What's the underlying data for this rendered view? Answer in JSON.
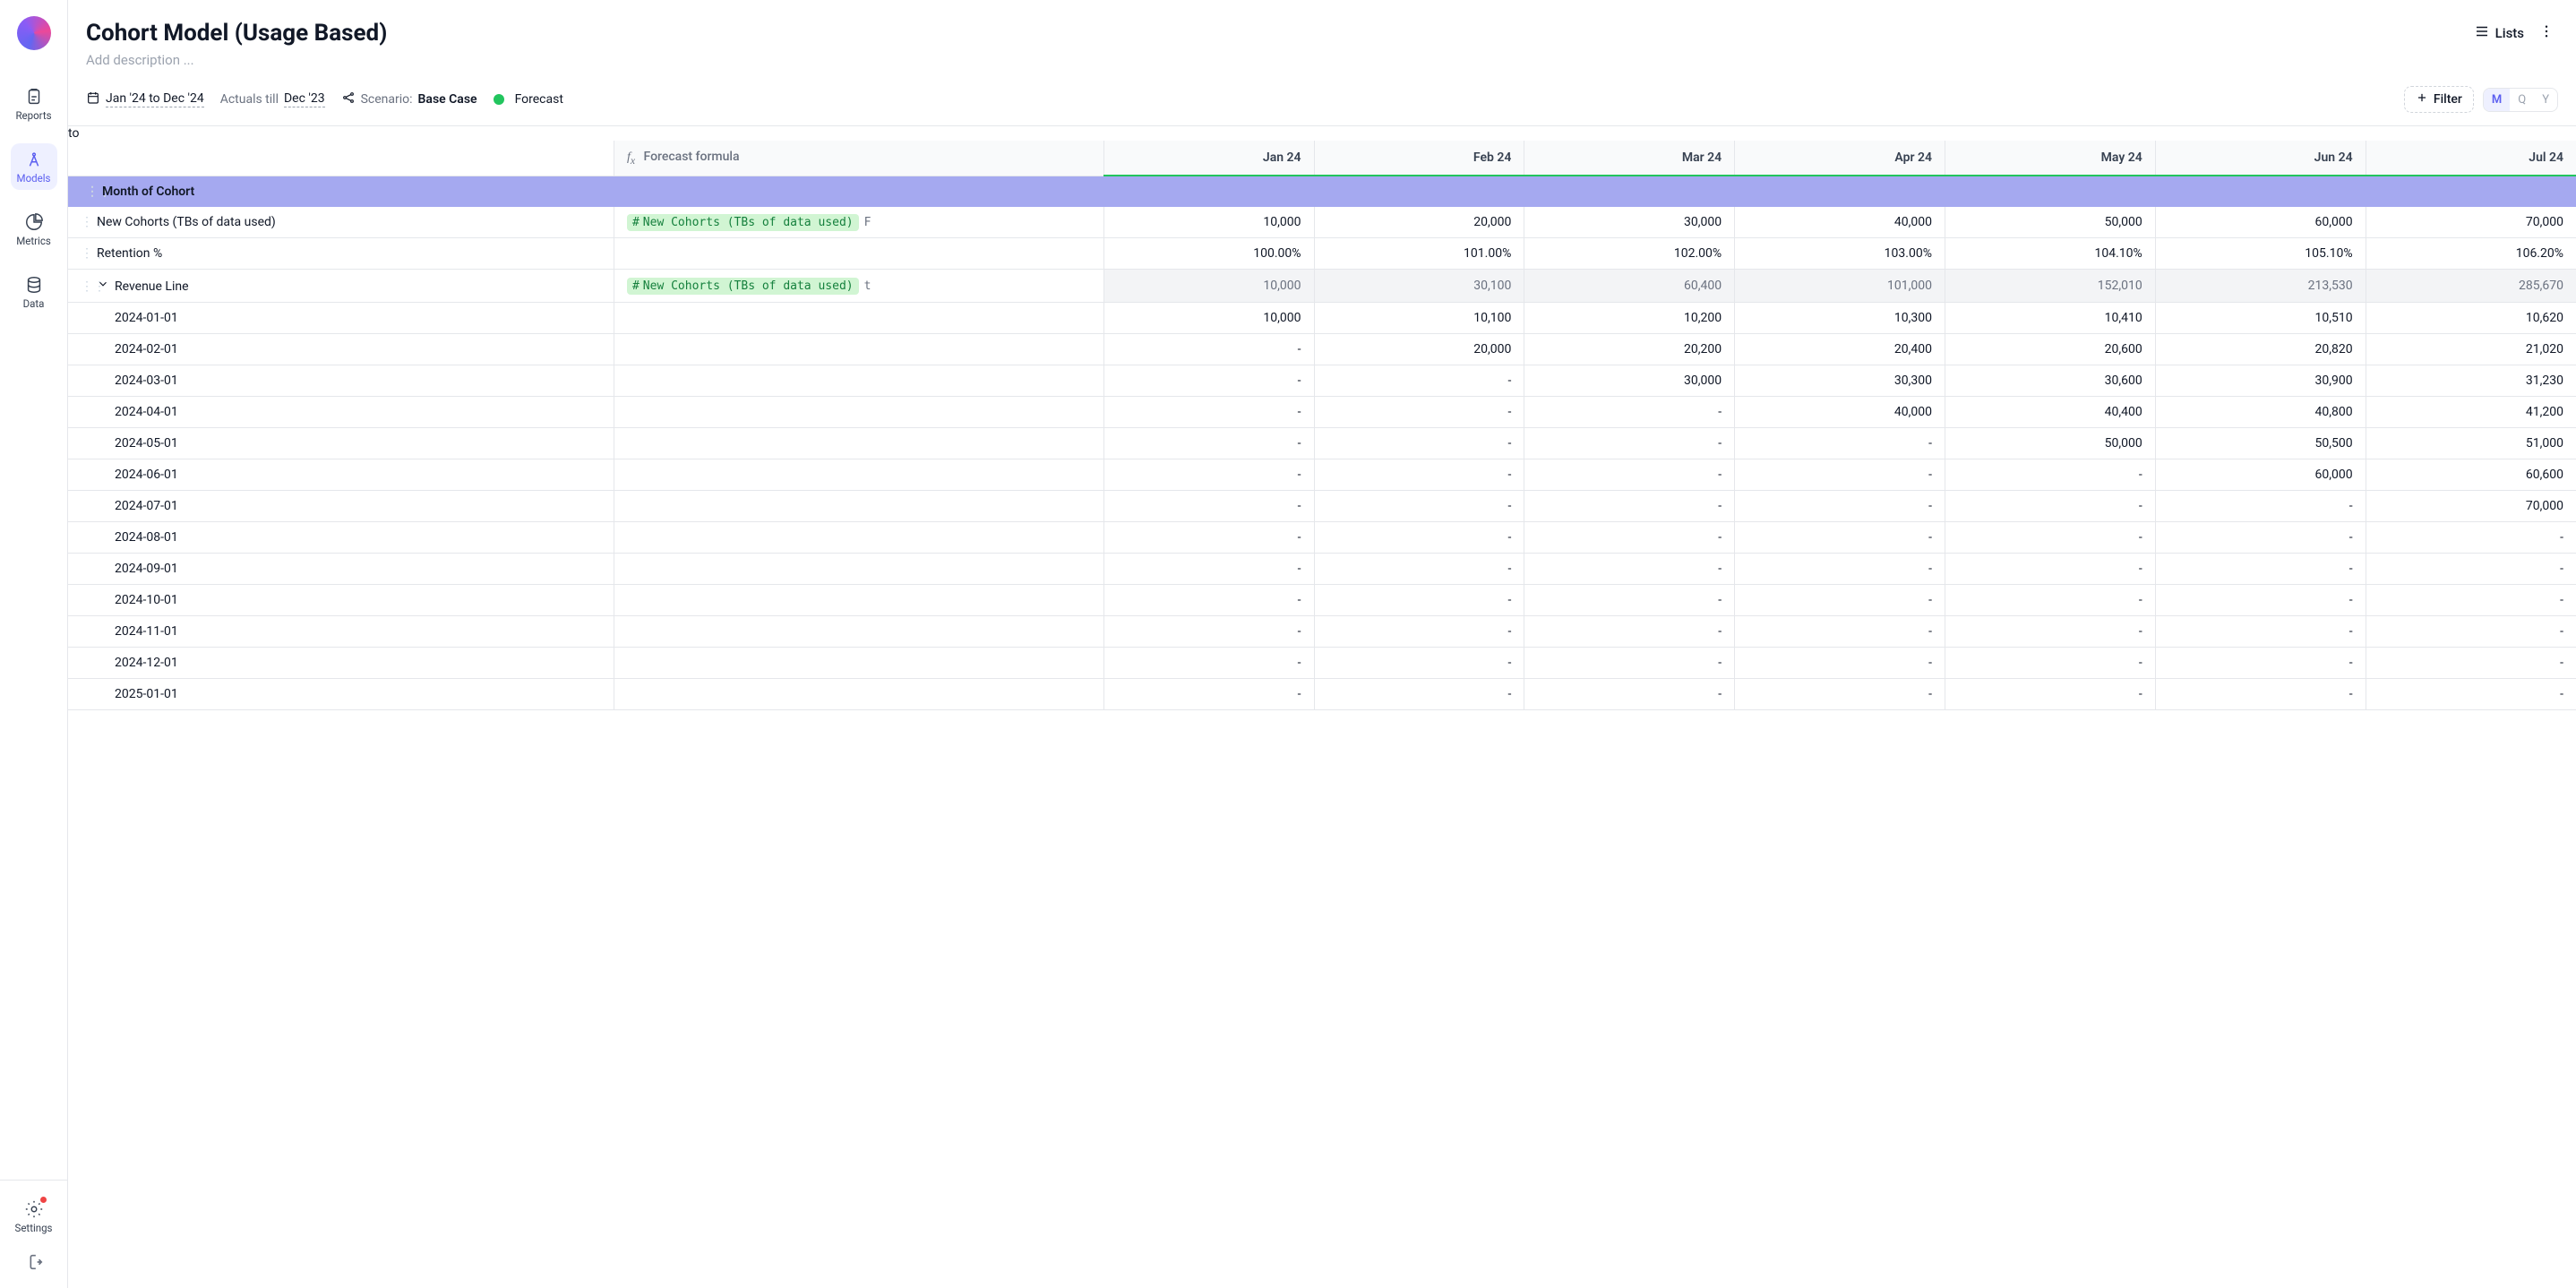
{
  "sidebar": {
    "items": [
      {
        "key": "reports",
        "label": "Reports"
      },
      {
        "key": "models",
        "label": "Models"
      },
      {
        "key": "metrics",
        "label": "Metrics"
      },
      {
        "key": "data",
        "label": "Data"
      }
    ],
    "settings_label": "Settings"
  },
  "header": {
    "title": "Cohort Model (Usage Based)",
    "description_placeholder": "Add description ...",
    "lists_label": "Lists"
  },
  "toolbar": {
    "date_range": "Jan '24 to Dec '24",
    "actuals_label": "Actuals till",
    "actuals_till": "Dec '23",
    "scenario_label": "Scenario:",
    "scenario_value": "Base Case",
    "forecast_label": "Forecast",
    "filter_label": "Filter",
    "granularity": {
      "m": "M",
      "q": "Q",
      "y": "Y"
    }
  },
  "grid": {
    "formula_header": "Forecast formula",
    "months": [
      "Jan 24",
      "Feb 24",
      "Mar 24",
      "Apr 24",
      "May 24",
      "Jun 24",
      "Jul 24"
    ],
    "section_label": "Month of Cohort",
    "rows": [
      {
        "id": "new_cohorts",
        "label": "New Cohorts (TBs of data used)",
        "formula_tag": "New Cohorts (TBs of data used)",
        "formula_trail": "F",
        "values": [
          "10,000",
          "20,000",
          "30,000",
          "40,000",
          "50,000",
          "60,000",
          "70,000"
        ]
      },
      {
        "id": "retention",
        "label": "Retention %",
        "values": [
          "100.00%",
          "101.00%",
          "102.00%",
          "103.00%",
          "104.10%",
          "105.10%",
          "106.20%"
        ]
      },
      {
        "id": "revenue_line",
        "label": "Revenue Line",
        "expandable": true,
        "agg": true,
        "formula_tag": "New Cohorts (TBs of data used)",
        "formula_trail": "t",
        "values": [
          "10,000",
          "30,100",
          "60,400",
          "101,000",
          "152,010",
          "213,530",
          "285,670"
        ]
      }
    ],
    "subrows": [
      {
        "label": "2024-01-01",
        "values": [
          "10,000",
          "10,100",
          "10,200",
          "10,300",
          "10,410",
          "10,510",
          "10,620"
        ]
      },
      {
        "label": "2024-02-01",
        "values": [
          "-",
          "20,000",
          "20,200",
          "20,400",
          "20,600",
          "20,820",
          "21,020"
        ]
      },
      {
        "label": "2024-03-01",
        "values": [
          "-",
          "-",
          "30,000",
          "30,300",
          "30,600",
          "30,900",
          "31,230"
        ]
      },
      {
        "label": "2024-04-01",
        "values": [
          "-",
          "-",
          "-",
          "40,000",
          "40,400",
          "40,800",
          "41,200"
        ]
      },
      {
        "label": "2024-05-01",
        "values": [
          "-",
          "-",
          "-",
          "-",
          "50,000",
          "50,500",
          "51,000"
        ]
      },
      {
        "label": "2024-06-01",
        "values": [
          "-",
          "-",
          "-",
          "-",
          "-",
          "60,000",
          "60,600"
        ]
      },
      {
        "label": "2024-07-01",
        "values": [
          "-",
          "-",
          "-",
          "-",
          "-",
          "-",
          "70,000"
        ]
      },
      {
        "label": "2024-08-01",
        "values": [
          "-",
          "-",
          "-",
          "-",
          "-",
          "-",
          "-"
        ]
      },
      {
        "label": "2024-09-01",
        "values": [
          "-",
          "-",
          "-",
          "-",
          "-",
          "-",
          "-"
        ]
      },
      {
        "label": "2024-10-01",
        "values": [
          "-",
          "-",
          "-",
          "-",
          "-",
          "-",
          "-"
        ]
      },
      {
        "label": "2024-11-01",
        "values": [
          "-",
          "-",
          "-",
          "-",
          "-",
          "-",
          "-"
        ]
      },
      {
        "label": "2024-12-01",
        "values": [
          "-",
          "-",
          "-",
          "-",
          "-",
          "-",
          "-"
        ]
      },
      {
        "label": "2025-01-01",
        "values": [
          "-",
          "-",
          "-",
          "-",
          "-",
          "-",
          "-"
        ]
      }
    ]
  }
}
